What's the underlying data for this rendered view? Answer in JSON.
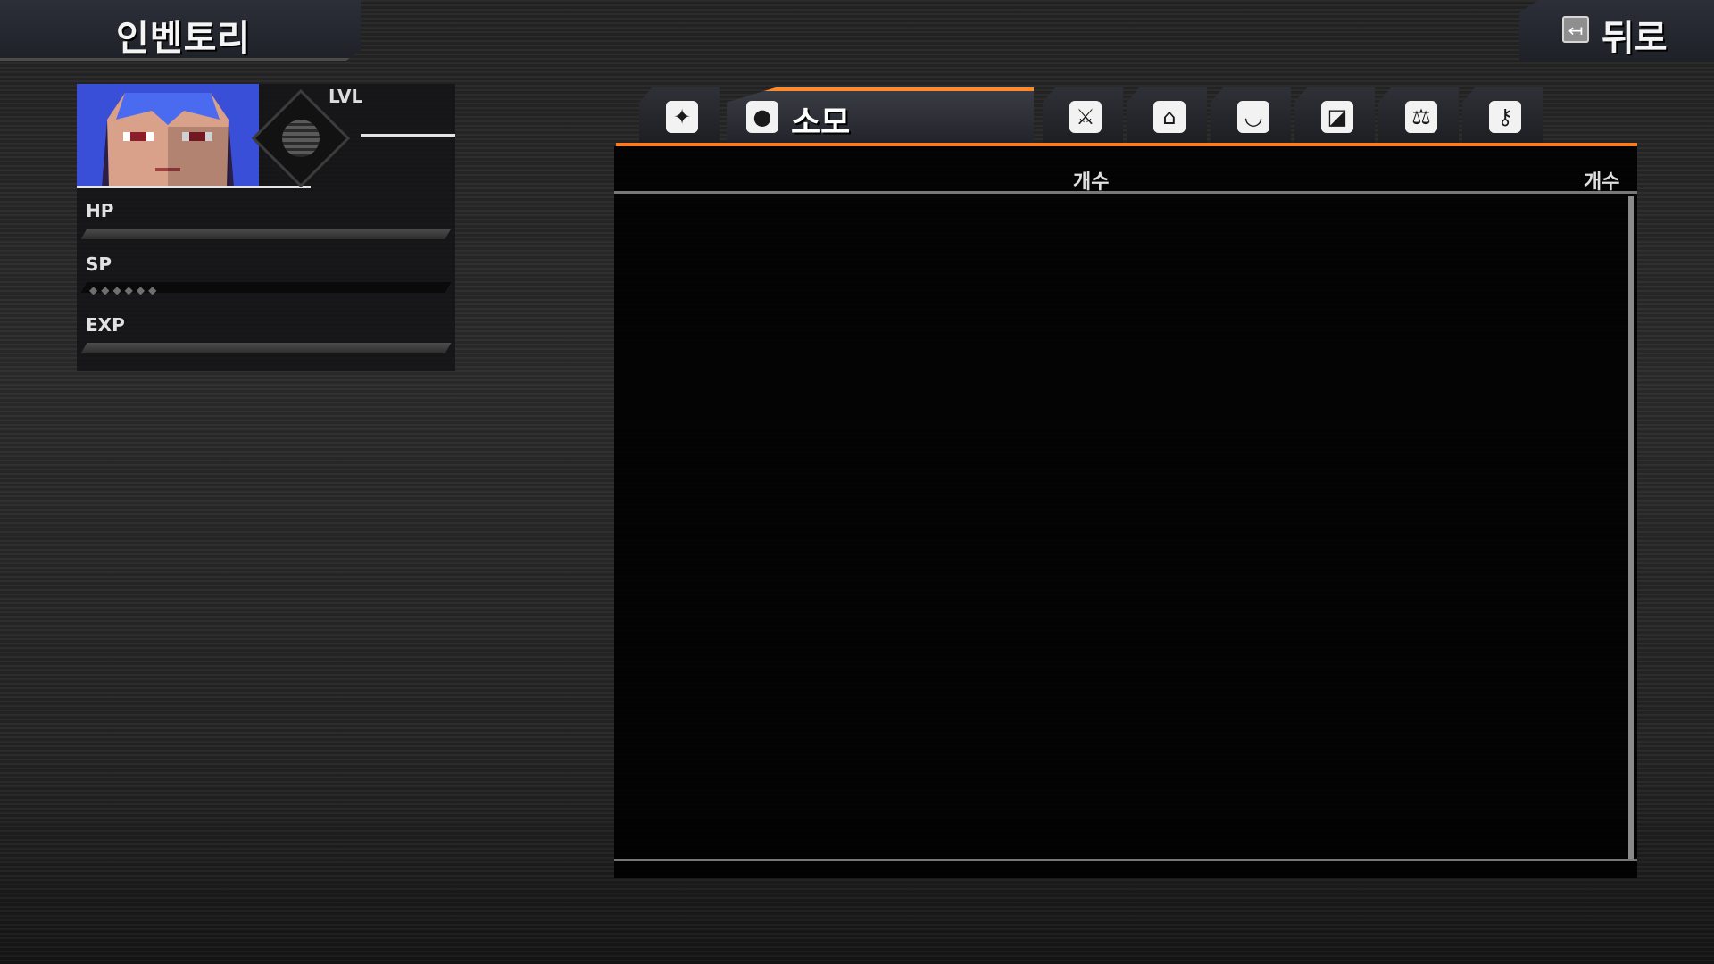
{
  "header": {
    "title": "인벤토리",
    "back_label": "뒤로",
    "back_icon": "back-arrow-icon"
  },
  "character": {
    "level_label": "LVL",
    "hp_label": "HP",
    "sp_label": "SP",
    "exp_label": "EXP",
    "hp_fraction": 1.0,
    "exp_fraction": 1.0
  },
  "tabs": [
    {
      "icon": "star-icon",
      "glyph": "✦",
      "label": ""
    },
    {
      "icon": "potion-icon",
      "glyph": "●",
      "label": "소모",
      "active": true
    },
    {
      "icon": "sword-icon",
      "glyph": "⚔",
      "label": ""
    },
    {
      "icon": "helmet-icon",
      "glyph": "⌂",
      "label": ""
    },
    {
      "icon": "armor-icon",
      "glyph": "◡",
      "label": ""
    },
    {
      "icon": "boots-icon",
      "glyph": "◪",
      "label": ""
    },
    {
      "icon": "balance-icon",
      "glyph": "⚖",
      "label": ""
    },
    {
      "icon": "key-icon",
      "glyph": "⚷",
      "label": ""
    }
  ],
  "list": {
    "col_header_1": "개수",
    "col_header_2": "개수"
  },
  "colors": {
    "accent": "#ff7a1a",
    "panel": "#000000"
  }
}
